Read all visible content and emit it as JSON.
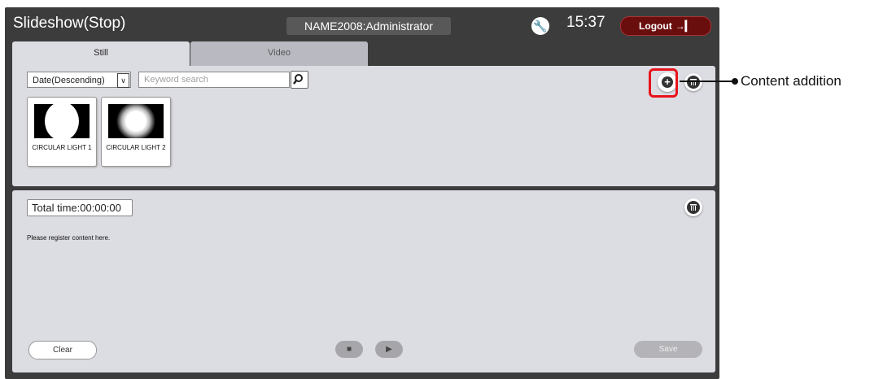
{
  "titlebar": {
    "title": "Slideshow(Stop)",
    "user": "NAME2008:Administrator",
    "settings_icon": "wrench-icon",
    "time": "15:37",
    "logout_label": "Logout",
    "logout_icon": "logout-icon"
  },
  "tabs": [
    {
      "label": "Still",
      "active": true
    },
    {
      "label": "Video",
      "active": false
    }
  ],
  "content_panel": {
    "sort_value": "Date(Descending)",
    "search_placeholder": "Keyword search",
    "search_icon": "search-icon",
    "add_icon": "add-circle-icon",
    "delete_icon": "trash-icon",
    "items": [
      {
        "label": "CIRCULAR LIGHT 1",
        "thumbnail": "hard-circle"
      },
      {
        "label": "CIRCULAR LIGHT 2",
        "thumbnail": "soft-circle"
      }
    ]
  },
  "playlist_panel": {
    "total_time": "Total time:00:00:00",
    "hint": "Please register content here.",
    "delete_icon": "trash-icon",
    "clear_label": "Clear",
    "stop_icon": "stop-icon",
    "play_icon": "play-icon",
    "save_label": "Save"
  },
  "annotation": {
    "label": "Content addition",
    "color": "#e8121b"
  }
}
